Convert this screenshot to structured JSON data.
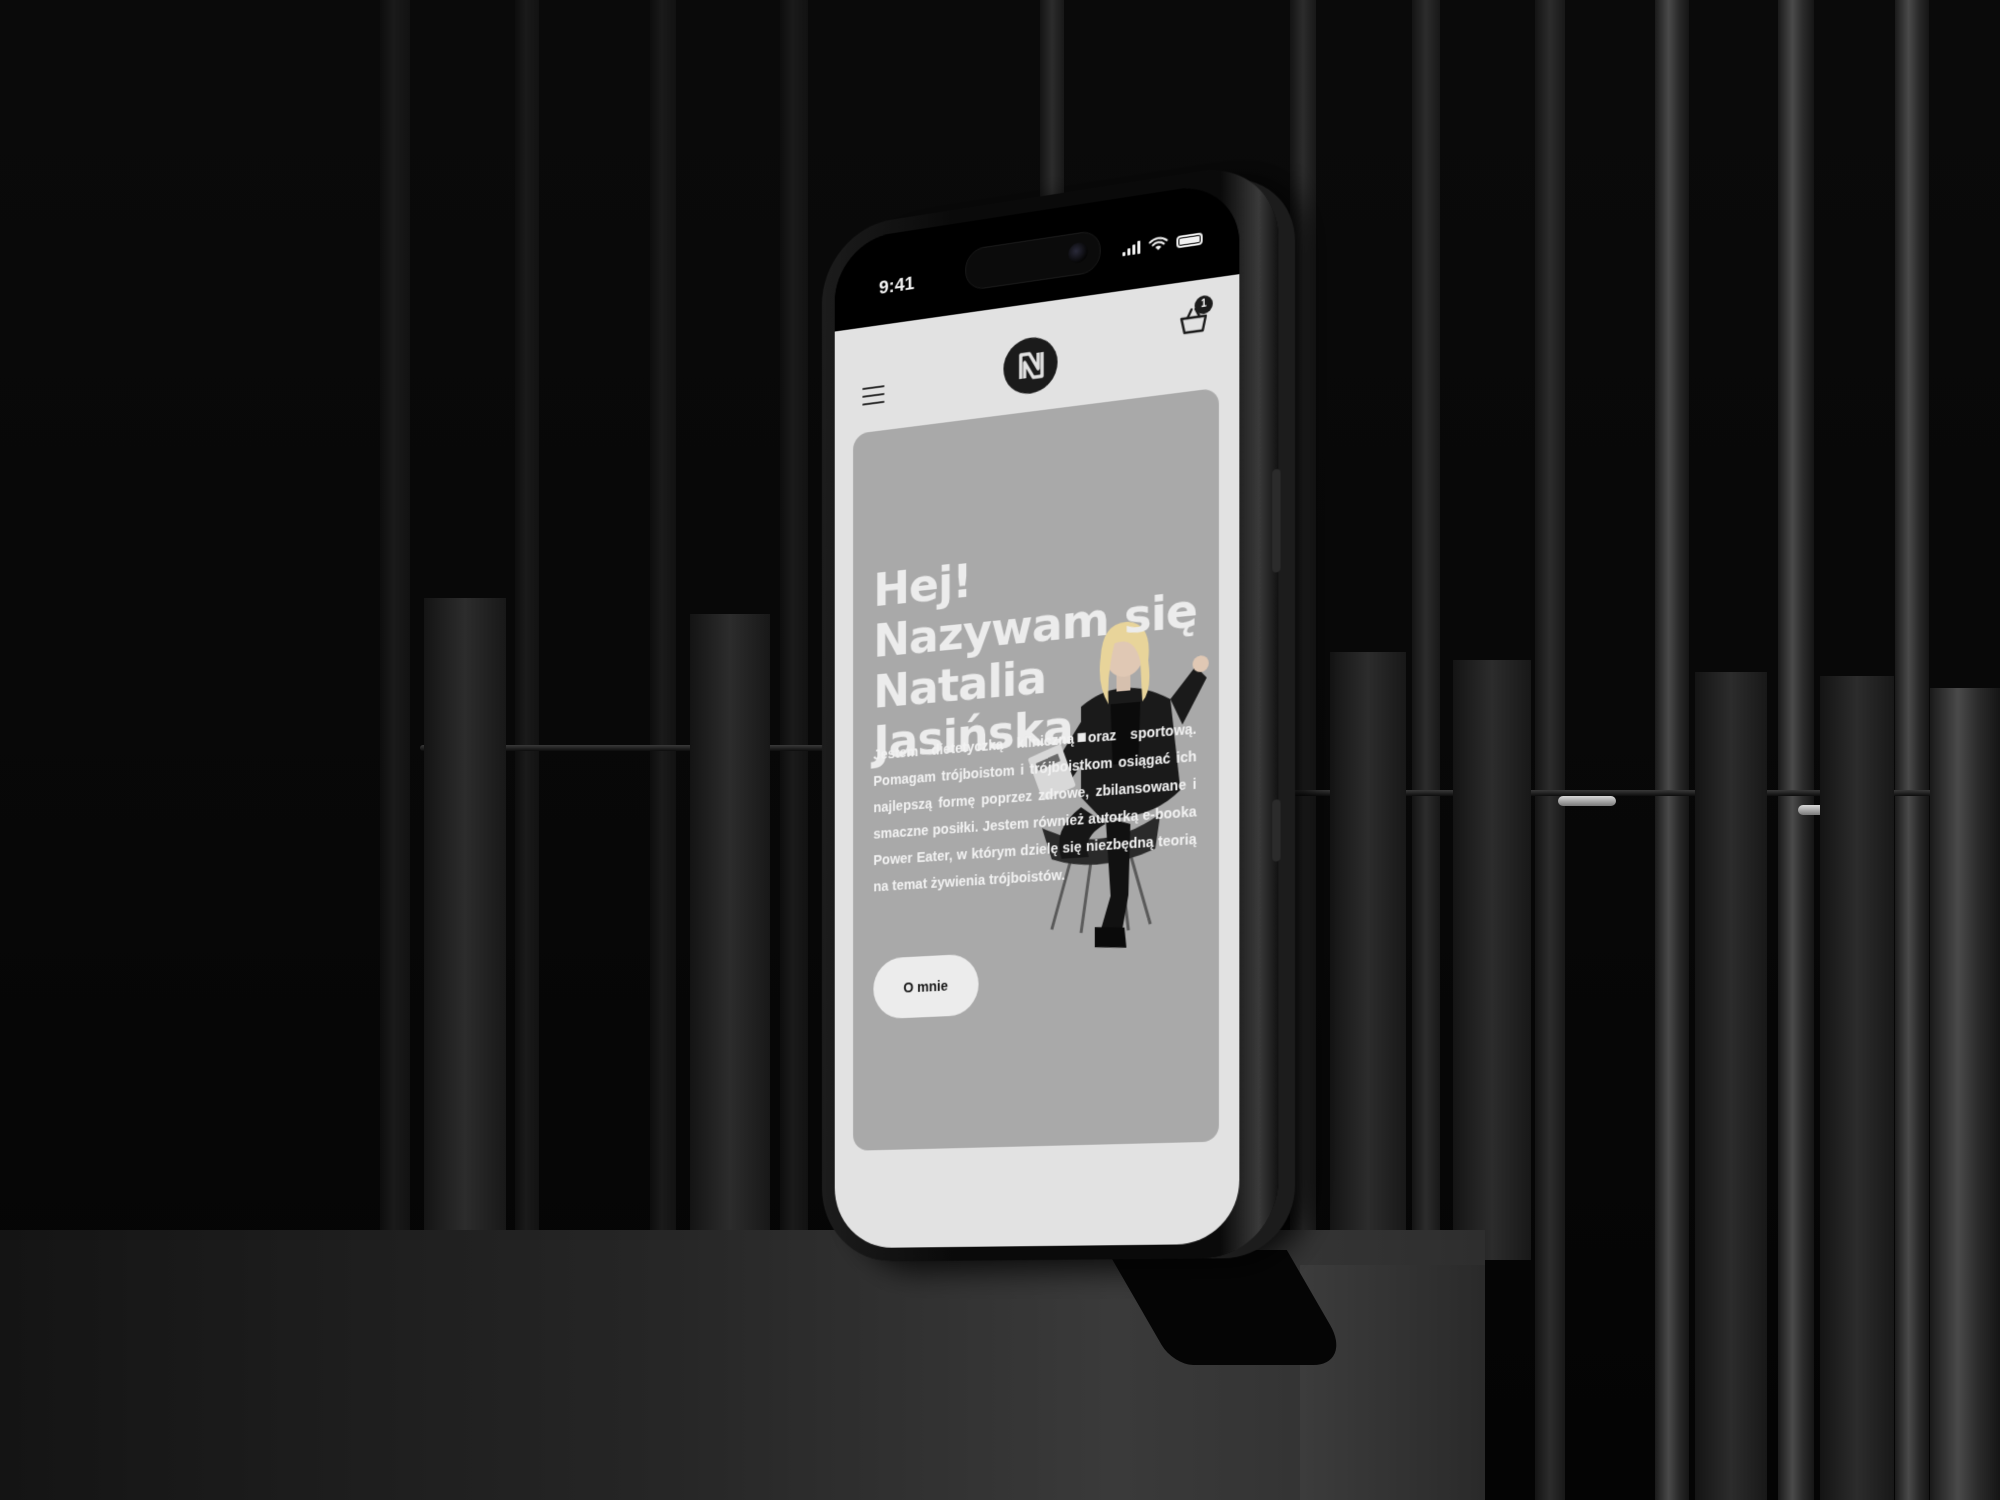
{
  "status_bar": {
    "time": "9:41"
  },
  "header": {
    "logo_icon": "n-monogram-logo-icon",
    "menu_icon": "hamburger-menu-icon",
    "cart_icon": "basket-icon",
    "cart_count": "1"
  },
  "hero": {
    "title": "Hej! Nazywam się Natalia Jasińska.",
    "description": "Jestem dietetyczką kliniczną oraz sportową. Pomagam trójboistom i trójboistkom osiągać ich najlepszą formę poprzez zdrowe, zbilansowane i smaczne posiłki. Jestem również autorką e-booka Power Eater, w którym dzielę się niezbędną teorią na temat żywienia trójboistów.",
    "button_label": "O mnie"
  },
  "colors": {
    "app_background": "#e2e2e2",
    "card_background": "#a9a9a9",
    "text_light": "#ececec",
    "logo_dark": "#1b1b1b"
  }
}
